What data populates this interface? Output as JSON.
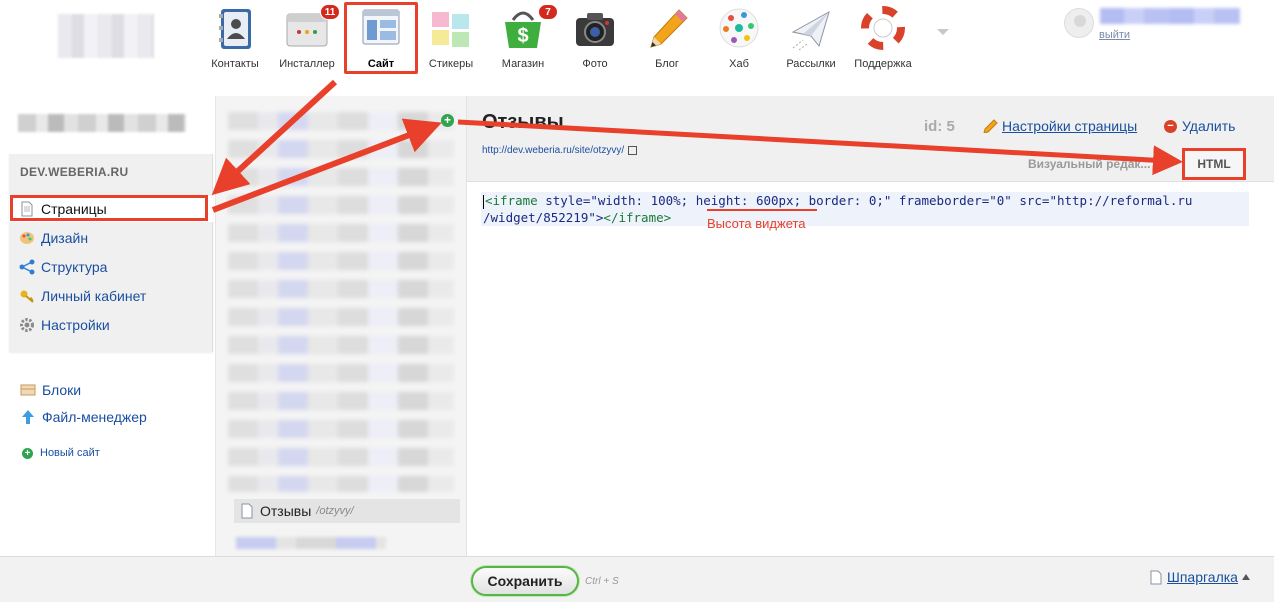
{
  "apps": [
    {
      "label": "Контакты",
      "icon": "contacts-book-icon",
      "badge": ""
    },
    {
      "label": "Инсталлер",
      "icon": "installer-window-icon",
      "badge": "11"
    },
    {
      "label": "Сайт",
      "icon": "site-layout-icon",
      "badge": "",
      "active": true
    },
    {
      "label": "Стикеры",
      "icon": "sticky-notes-icon",
      "badge": ""
    },
    {
      "label": "Магазин",
      "icon": "shop-basket-icon",
      "badge": "7"
    },
    {
      "label": "Фото",
      "icon": "camera-icon",
      "badge": ""
    },
    {
      "label": "Блог",
      "icon": "pencil-icon",
      "badge": ""
    },
    {
      "label": "Хаб",
      "icon": "hub-colorful-icon",
      "badge": ""
    },
    {
      "label": "Рассылки",
      "icon": "paper-plane-icon",
      "badge": ""
    },
    {
      "label": "Поддержка",
      "icon": "lifebuoy-icon",
      "badge": ""
    }
  ],
  "user": {
    "logout_label": "выйти"
  },
  "sidebar": {
    "site_name": "DEV.WEBERIA.RU",
    "items": [
      {
        "label": "Страницы",
        "icon": "page-icon",
        "current": true
      },
      {
        "label": "Дизайн",
        "icon": "palette-icon"
      },
      {
        "label": "Структура",
        "icon": "structure-icon"
      },
      {
        "label": "Личный кабинет",
        "icon": "key-icon"
      },
      {
        "label": "Настройки",
        "icon": "gear-icon"
      }
    ],
    "extra": [
      {
        "label": "Блоки",
        "icon": "blocks-icon"
      },
      {
        "label": "Файл-менеджер",
        "icon": "upload-arrow-icon"
      }
    ],
    "new_site_label": "Новый сайт"
  },
  "pages": {
    "current_title": "Отзывы",
    "current_slug": "/otzyvy/"
  },
  "editor": {
    "page_title": "Отзывы",
    "page_url": "http://dev.weberia.ru/site/otzyvy/",
    "id_label": "id: 5",
    "settings_label": "Настройки страницы",
    "delete_label": "Удалить",
    "visual_tab_label": "Визуальный редак...",
    "html_tab_label": "HTML",
    "code_line1_tag_open": "<iframe",
    "code_line1_part1": " style=\"width: 100%; ",
    "code_line1_height": "height: 600px;",
    "code_line1_part2": " border: 0;\" frameborder=\"0\" src=\"http://reformal.ru",
    "code_line2_part1": "/widget/852219\">",
    "code_line2_tag_close": "</iframe>",
    "annotation": "Высота виджета"
  },
  "footer": {
    "save_label": "Сохранить",
    "shortcut": "Ctrl + S",
    "cheatsheet_label": "Шпаргалка"
  },
  "colors": {
    "accent_red": "#e8402a",
    "link_blue": "#1a4fa0",
    "save_green": "#56b544"
  }
}
